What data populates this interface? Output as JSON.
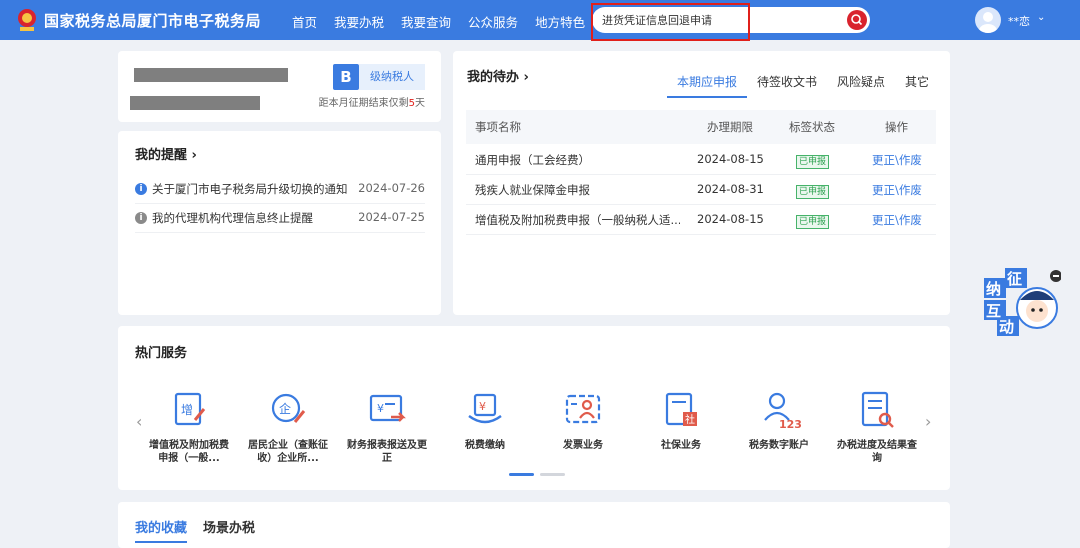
{
  "header": {
    "site_title": "国家税务总局厦门市电子税务局",
    "nav": [
      "首页",
      "我要办税",
      "我要查询",
      "公众服务",
      "地方特色"
    ],
    "search_value": "进货凭证信息回退申请",
    "user_name": "**恋",
    "caret": "⌄",
    "colors": {
      "bar": "#3a7be0",
      "highlight": "#e0201b"
    }
  },
  "profile": {
    "badge": "B",
    "level": "级纳税人",
    "deadline_prefix": "距本月征期结束仅剩",
    "deadline_days": "5",
    "deadline_suffix": "天"
  },
  "reminders": {
    "title": "我的提醒",
    "arrow": "›",
    "items": [
      {
        "text": "关于厦门市电子税务局升级切换的通知",
        "date": "2024-07-26",
        "icon": "info-icon",
        "color": "#3a7be0"
      },
      {
        "text": "我的代理机构代理信息终止提醒",
        "date": "2024-07-25",
        "icon": "info-icon",
        "color": "#8a8a8a"
      }
    ]
  },
  "todo": {
    "title": "我的待办",
    "arrow": "›",
    "tabs": [
      "本期应申报",
      "待签收文书",
      "风险疑点",
      "其它"
    ],
    "active_tab": 0,
    "columns": [
      "事项名称",
      "办理期限",
      "标签状态",
      "操作"
    ],
    "rows": [
      {
        "name": "通用申报（工会经费）",
        "deadline": "2024-08-15",
        "status": "已申报",
        "action": "更正\\作废"
      },
      {
        "name": "残疾人就业保障金申报",
        "deadline": "2024-08-31",
        "status": "已申报",
        "action": "更正\\作废"
      },
      {
        "name": "增值税及附加税费申报（一般纳税人适...",
        "deadline": "2024-08-15",
        "status": "已申报",
        "action": "更正\\作废"
      }
    ]
  },
  "hot_services": {
    "title": "热门服务",
    "prev": "‹",
    "next": "›",
    "items": [
      {
        "label": "增值税及附加税费申报（一般...",
        "icon": "vat-declare-icon"
      },
      {
        "label": "居民企业（查账征收）企业所...",
        "icon": "enterprise-tax-icon"
      },
      {
        "label": "财务报表报送及更正",
        "icon": "financial-report-icon"
      },
      {
        "label": "税费缴纳",
        "icon": "tax-payment-icon"
      },
      {
        "label": "发票业务",
        "icon": "invoice-icon"
      },
      {
        "label": "社保业务",
        "icon": "social-security-icon"
      },
      {
        "label": "税务数字账户",
        "icon": "digital-account-icon"
      },
      {
        "label": "办税进度及结果查询",
        "icon": "progress-query-icon"
      }
    ]
  },
  "favorites": {
    "tabs": [
      "我的收藏",
      "场景办税"
    ]
  },
  "mascot": {
    "chars": [
      "征",
      "纳",
      "互",
      "动"
    ],
    "icon": "customer-service-mascot-icon"
  }
}
